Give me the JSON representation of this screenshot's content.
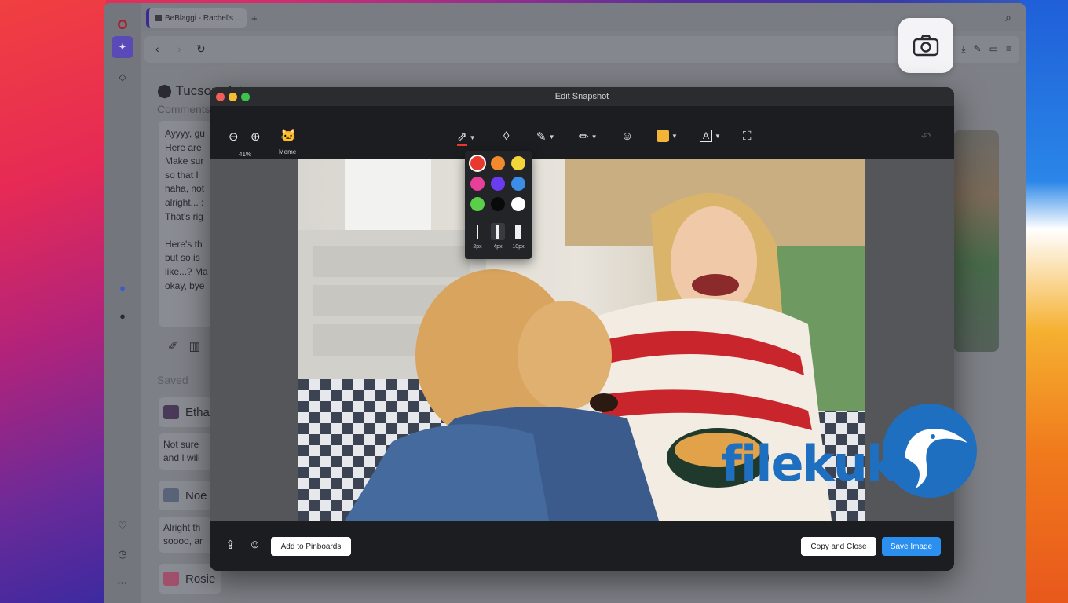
{
  "browser": {
    "tab_label": "BeBlaggi - Rachel's ...",
    "new_tab": "+",
    "location": "Tucson, Arizona",
    "comments_label": "Comments",
    "note_lines": [
      "Ayyyy, gu",
      "Here are",
      "Make sur",
      "so that I",
      "haha, not",
      "alright... :",
      "That's rig",
      "",
      "Here's th",
      "but so is",
      "like...? Ma",
      "okay, bye"
    ],
    "saved_label": "Saved",
    "saved_items": [
      {
        "title": "Etha",
        "lines": [
          "Not sure",
          "and I will"
        ],
        "color": "#4a3a5a"
      },
      {
        "title": "Noe",
        "lines": [
          "Alright th",
          "soooo, ar"
        ],
        "color": "#5a6478"
      },
      {
        "title": "Rosie",
        "lines": [],
        "color": "#a0506a"
      }
    ]
  },
  "dialog": {
    "title": "Edit Snapshot",
    "zoom_level": "41%",
    "meme_label": "Meme",
    "stroke_sizes": [
      "2px",
      "4px",
      "10px"
    ],
    "colors": [
      "#e8392f",
      "#f08a2c",
      "#f3d73a",
      "#e8409a",
      "#6a3cf0",
      "#3b8de8",
      "#5ad04a",
      "#0a0a0a",
      "#ffffff"
    ],
    "selected_color": "#e8392f",
    "add_to_pinboards": "Add to Pinboards",
    "copy_and_close": "Copy and Close",
    "save_image": "Save Image"
  },
  "watermark": {
    "text": "filekuka"
  }
}
